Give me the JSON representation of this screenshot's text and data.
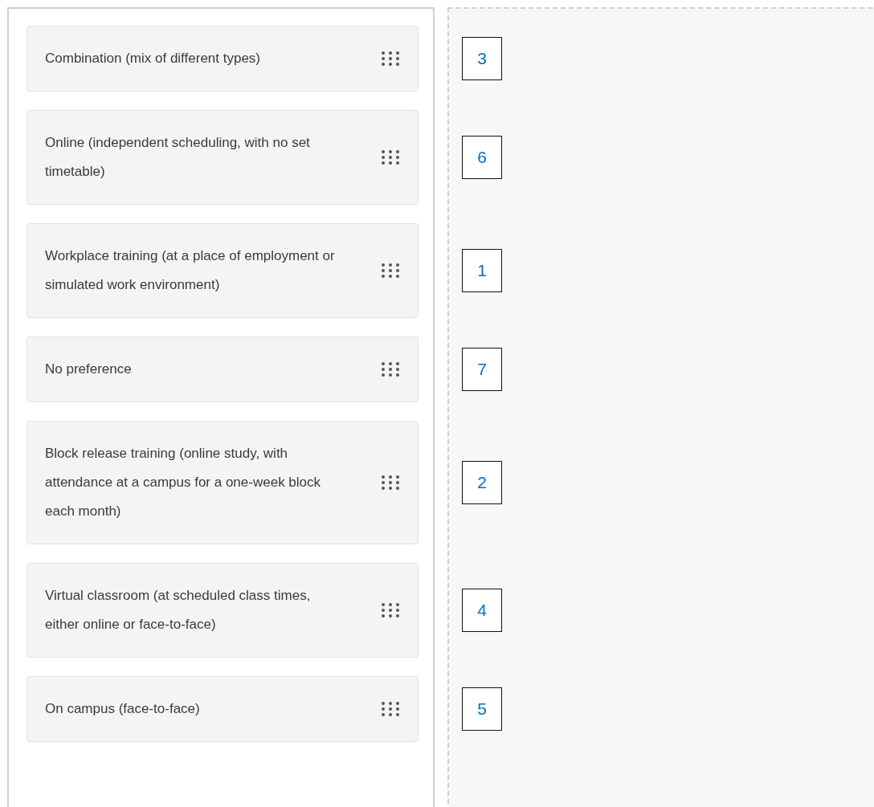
{
  "items": [
    {
      "label": "Combination (mix of different types)",
      "rank": "3"
    },
    {
      "label": "Online (independent scheduling, with no set timetable)",
      "rank": "6"
    },
    {
      "label": "Workplace training (at a place of employment or simulated work environment)",
      "rank": "1"
    },
    {
      "label": "No preference",
      "rank": "7"
    },
    {
      "label": "Block release training (online study, with attendance at a campus for a one-week block each month)",
      "rank": "2"
    },
    {
      "label": "Virtual classroom (at scheduled class times, either online or face-to-face)",
      "rank": "4"
    },
    {
      "label": "On campus (face-to-face)",
      "rank": "5"
    }
  ]
}
